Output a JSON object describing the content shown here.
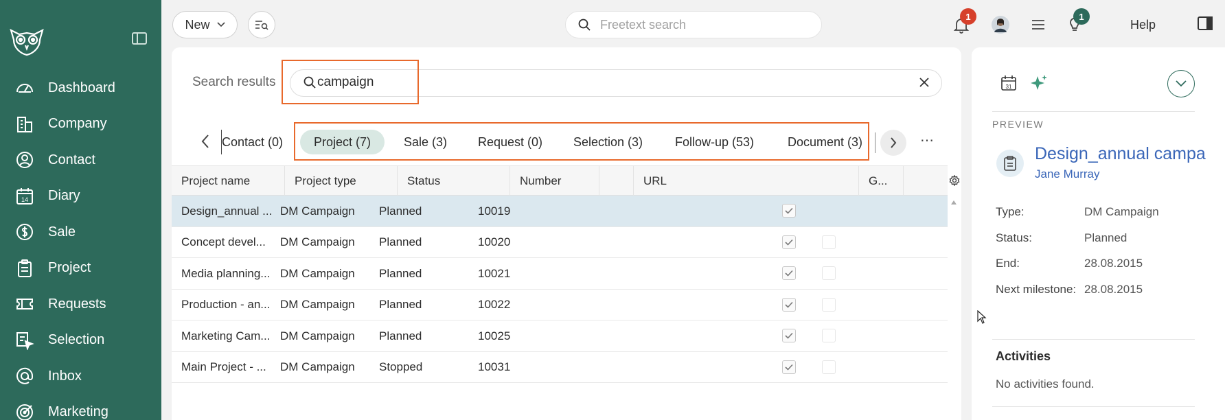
{
  "sidebar": {
    "items": [
      {
        "label": "Dashboard",
        "icon": "gauge-icon"
      },
      {
        "label": "Company",
        "icon": "building-icon"
      },
      {
        "label": "Contact",
        "icon": "user-circle-icon"
      },
      {
        "label": "Diary",
        "icon": "calendar-icon"
      },
      {
        "label": "Sale",
        "icon": "dollar-icon"
      },
      {
        "label": "Project",
        "icon": "clipboard-icon"
      },
      {
        "label": "Requests",
        "icon": "ticket-icon"
      },
      {
        "label": "Selection",
        "icon": "selection-icon"
      },
      {
        "label": "Inbox",
        "icon": "at-icon"
      },
      {
        "label": "Marketing",
        "icon": "target-icon"
      }
    ],
    "diary_day": "14"
  },
  "topbar": {
    "new_label": "New",
    "search_placeholder": "Freetext search",
    "notifications_count": "1",
    "tips_count": "1",
    "help_label": "Help"
  },
  "search": {
    "label": "Search results",
    "query": "campaign"
  },
  "tabs": [
    {
      "label": "Contact (0)"
    },
    {
      "label": "Project (7)",
      "active": true
    },
    {
      "label": "Sale (3)"
    },
    {
      "label": "Request (0)"
    },
    {
      "label": "Selection (3)"
    },
    {
      "label": "Follow-up (53)"
    },
    {
      "label": "Document (3)"
    }
  ],
  "table": {
    "columns": [
      "Project name",
      "Project type",
      "Status",
      "Number",
      "",
      "URL",
      "G..."
    ],
    "rows": [
      {
        "name": "Design_annual ...",
        "type": "DM Campaign",
        "status": "Planned",
        "number": "10019",
        "checked": true,
        "extra": false
      },
      {
        "name": "Concept devel...",
        "type": "DM Campaign",
        "status": "Planned",
        "number": "10020",
        "checked": true,
        "extra": true
      },
      {
        "name": "Media planning...",
        "type": "DM Campaign",
        "status": "Planned",
        "number": "10021",
        "checked": true,
        "extra": true
      },
      {
        "name": "Production - an...",
        "type": "DM Campaign",
        "status": "Planned",
        "number": "10022",
        "checked": true,
        "extra": true
      },
      {
        "name": "Marketing Cam...",
        "type": "DM Campaign",
        "status": "Planned",
        "number": "10025",
        "checked": true,
        "extra": true
      },
      {
        "name": "Main Project - ...",
        "type": "DM Campaign",
        "status": "Stopped",
        "number": "10031",
        "checked": true,
        "extra": true
      }
    ]
  },
  "preview": {
    "section_label": "PREVIEW",
    "calendar_day": "31",
    "title": "Design_annual campa",
    "owner": "Jane Murray",
    "fields": [
      {
        "label": "Type:",
        "value": "DM Campaign"
      },
      {
        "label": "Status:",
        "value": "Planned"
      },
      {
        "label": "End:",
        "value": "28.08.2015"
      },
      {
        "label": "Next milestone:",
        "value": "28.08.2015"
      }
    ],
    "activities_heading": "Activities",
    "activities_empty": "No activities found."
  },
  "colors": {
    "sidebar": "#2d6a5b",
    "highlight": "#e8692c",
    "active_tab": "#d9e8e3",
    "selected_row": "#dbe8ef",
    "link": "#3a66b8",
    "badge": "#d6402b"
  }
}
